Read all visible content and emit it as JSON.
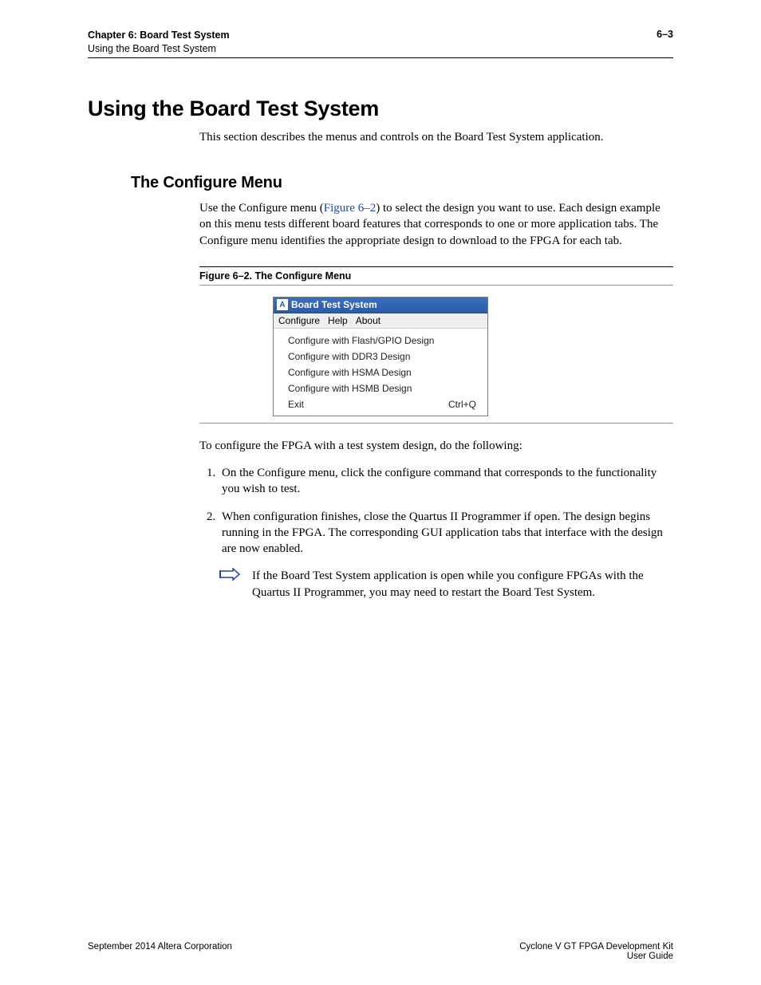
{
  "header": {
    "chapter": "Chapter 6: Board Test System",
    "section": "Using the Board Test System",
    "page_num": "6–3"
  },
  "h1": "Using the Board Test System",
  "intro": "This section describes the menus and controls on the Board Test System application.",
  "h2": "The Configure Menu",
  "p1_a": "Use the Configure menu (",
  "p1_ref": "Figure 6–2",
  "p1_b": ") to select the design you want to use. Each design example on this menu tests different board features that corresponds to one or more application tabs. The Configure menu identifies the appropriate design to download to the FPGA for each tab.",
  "fig_caption": "Figure 6–2. The Configure Menu",
  "dialog": {
    "title": "Board Test System",
    "logo_letter": "A",
    "menubar": [
      "Configure",
      "Help",
      "About"
    ],
    "items": [
      {
        "label": "Configure with Flash/GPIO Design",
        "shortcut": ""
      },
      {
        "label": "Configure with DDR3 Design",
        "shortcut": ""
      },
      {
        "label": "Configure with HSMA Design",
        "shortcut": ""
      },
      {
        "label": "Configure with HSMB Design",
        "shortcut": ""
      },
      {
        "label": "Exit",
        "shortcut": "Ctrl+Q"
      }
    ]
  },
  "p2": "To configure the FPGA with a test system design, do the following:",
  "steps": [
    "On the Configure menu, click the configure command that corresponds to the functionality you wish to test.",
    "When configuration finishes, close the Quartus II Programmer if open. The design begins running in the FPGA. The corresponding GUI application tabs that interface with the design are now enabled."
  ],
  "note": "If the Board Test System application is open while you configure FPGAs with the Quartus II Programmer, you may need to restart the Board Test System.",
  "footer": {
    "left": "September 2014   Altera Corporation",
    "right1": "Cyclone V GT FPGA Development Kit",
    "right2": "User Guide"
  }
}
